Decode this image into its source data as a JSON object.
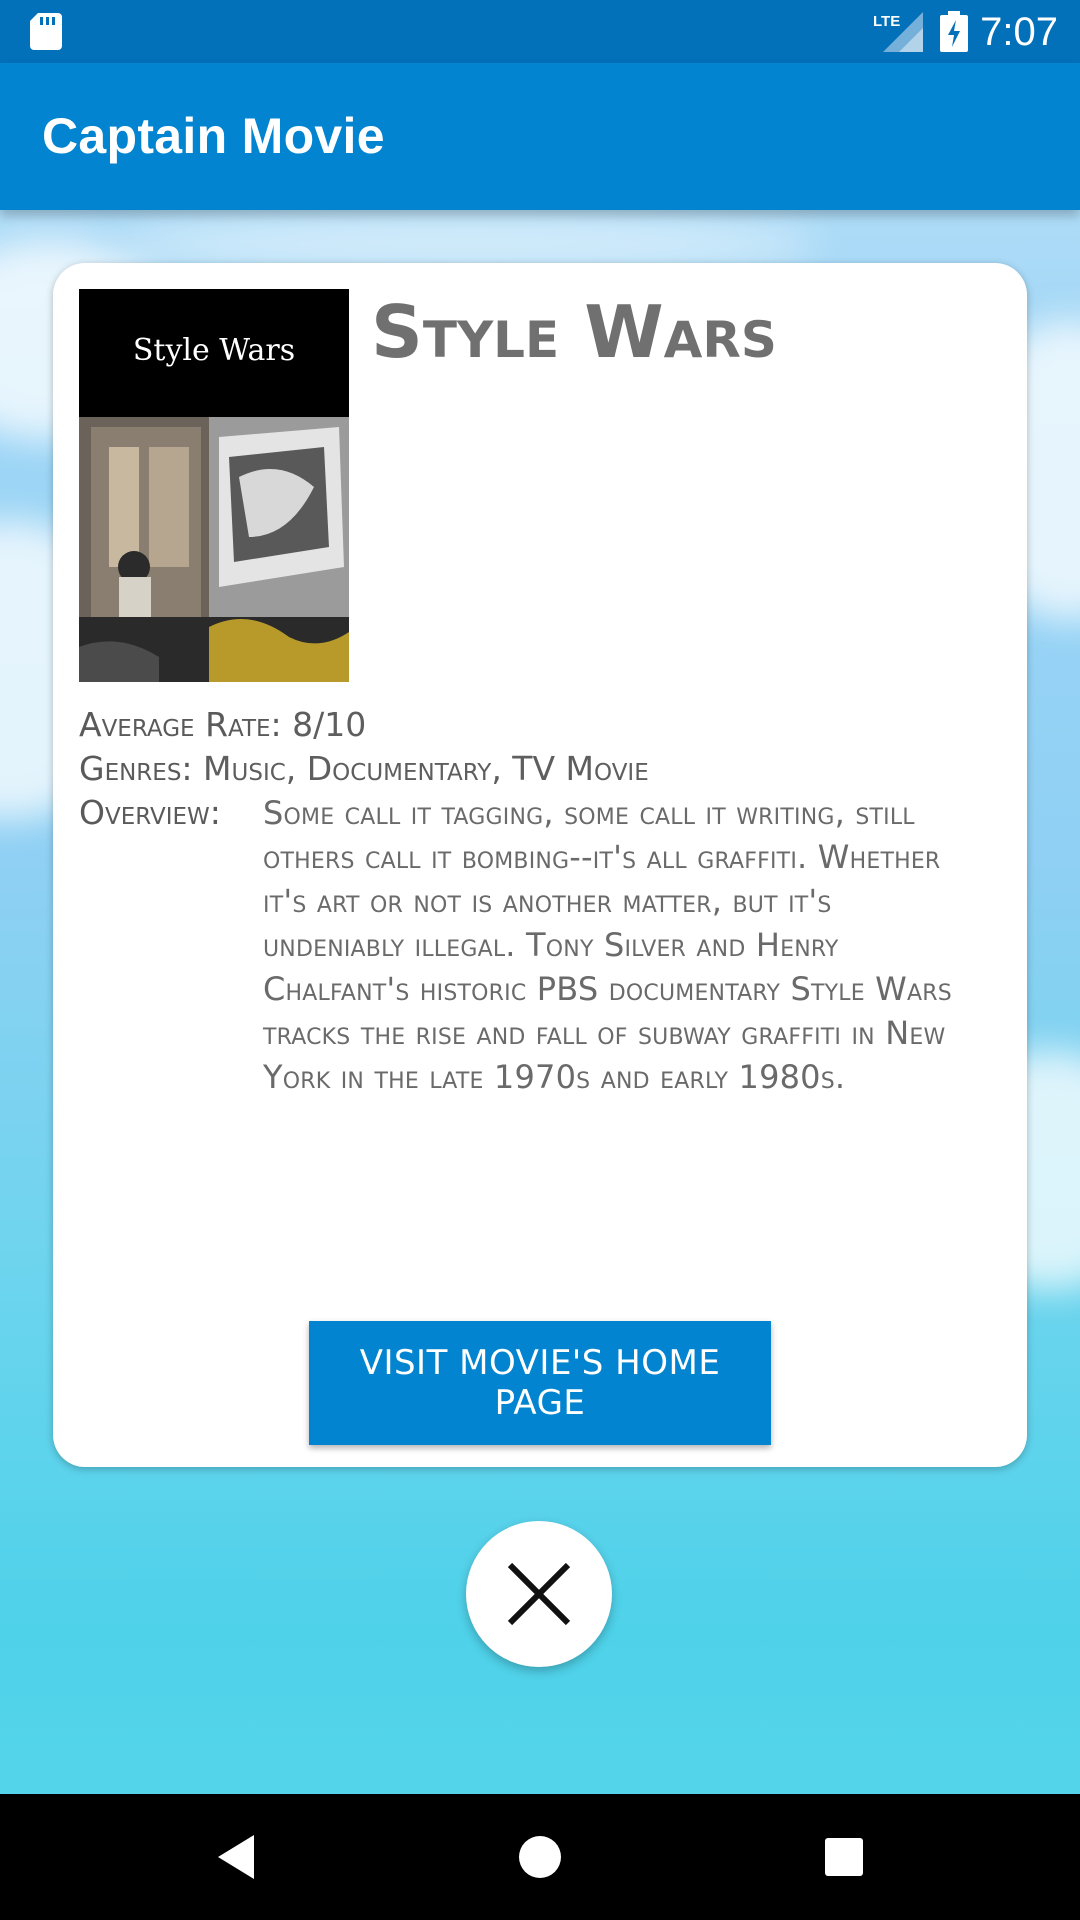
{
  "status_bar": {
    "time": "7:07",
    "network_label": "LTE",
    "icons": [
      "sd-card-icon",
      "lte-signal-icon",
      "battery-charging-icon"
    ]
  },
  "app_bar": {
    "title": "Captain Movie",
    "color": "#0284d0"
  },
  "movie": {
    "title": "Style Wars",
    "poster_title": "Style Wars",
    "rating_label": "Average Rate:",
    "rating_value": "8/10",
    "genres_label": "Genres:",
    "genres_value": "Music, Documentary, TV Movie",
    "overview_label": "Overview:",
    "overview_text": "Some call it tagging, some call it writing, still others call it bombing--it's all graffiti. Whether it's art or not is another matter, but it's undeniably illegal. Tony Silver and Henry Chalfant's historic PBS documentary Style Wars tracks the rise and fall of subway graffiti in New York in the late 1970s and early 1980s."
  },
  "actions": {
    "home_page_button": "VISIT MOVIE'S HOME PAGE",
    "close_icon": "close-icon"
  },
  "nav_bar": {
    "icons": [
      "back-icon",
      "home-icon",
      "recents-icon"
    ]
  }
}
